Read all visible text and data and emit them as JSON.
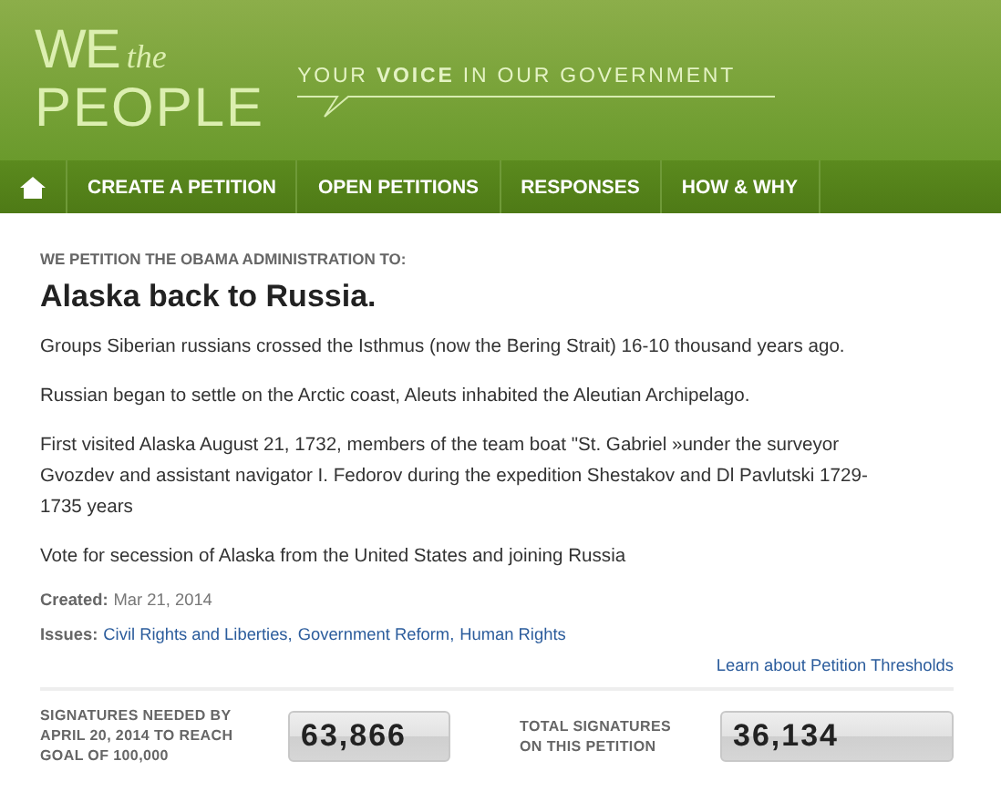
{
  "header": {
    "logo_we": "WE",
    "logo_the": "the",
    "logo_people": "PEOPLE",
    "tagline": "YOUR **VOICE** IN OUR GOVERNMENT"
  },
  "nav": {
    "items": [
      {
        "kind": "home"
      },
      {
        "kind": "text",
        "label": "CREATE A PETITION"
      },
      {
        "kind": "text",
        "label": "OPEN PETITIONS"
      },
      {
        "kind": "text",
        "label": "RESPONSES"
      },
      {
        "kind": "text",
        "label": "HOW & WHY"
      }
    ]
  },
  "petition": {
    "kicker": "WE PETITION THE OBAMA ADMINISTRATION TO:",
    "title": "Alaska back to Russia.",
    "paragraphs": [
      "Groups Siberian russians crossed the Isthmus (now the Bering Strait) 16-10 thousand years ago.",
      "Russian began to settle on the Arctic coast, Aleuts inhabited the Aleutian Archipelago.",
      "First visited Alaska August 21, 1732, members of the team boat \"St. Gabriel »under the surveyor Gvozdev and assistant navigator I. Fedorov during the expedition Shestakov and Dl Pavlutski 1729-1735 years",
      "Vote for secession of Alaska from the United States and joining Russia"
    ],
    "created_label": "Created:",
    "created": "Mar 21, 2014",
    "issues_label": "Issues:",
    "issues": [
      "Civil Rights and Liberties,",
      "Government Reform,",
      "Human Rights"
    ]
  },
  "thresholds_link": "Learn about Petition Thresholds",
  "counters": [
    {
      "label": "SIGNATURES NEEDED BY APRIL 20, 2014 TO REACH GOAL OF 100,000",
      "value": "63,866"
    },
    {
      "label": "TOTAL SIGNATURES ON THIS PETITION",
      "value": "36,134"
    }
  ]
}
